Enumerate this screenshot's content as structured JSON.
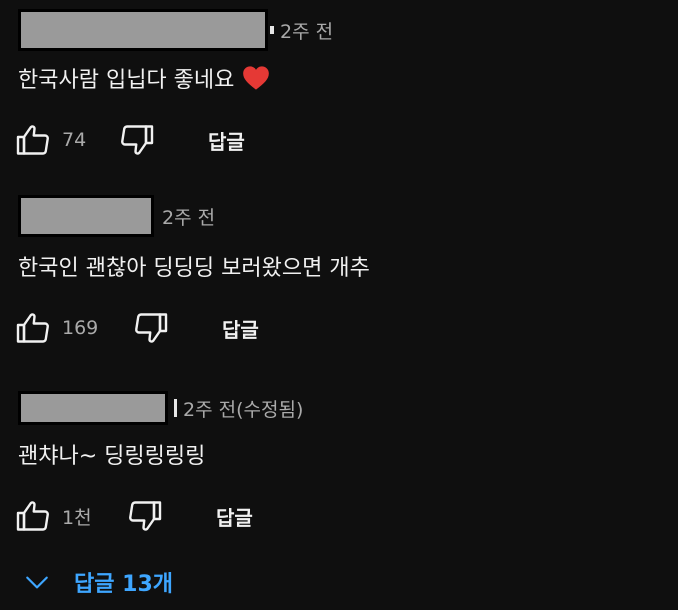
{
  "colors": {
    "background": "#0f0f0f",
    "text": "#f1f1f1",
    "meta": "#aaaaaa",
    "link": "#3ea6ff",
    "heart": "#e53935"
  },
  "comments": [
    {
      "time": "2주 전",
      "text": "한국사람 입닙다 좋네요",
      "emoji": "heart-icon",
      "likes": "74",
      "reply_label": "답글"
    },
    {
      "time": "2주 전",
      "text": "한국인 괜찮아 딩딩딩 보러왔으면 개추",
      "likes": "169",
      "reply_label": "답글"
    },
    {
      "time": "2주 전(수정됨)",
      "text": "괜챠나~ 딩링링링링",
      "likes": "1천",
      "reply_label": "답글"
    }
  ],
  "replies_toggle": {
    "label": "답글 13개"
  }
}
